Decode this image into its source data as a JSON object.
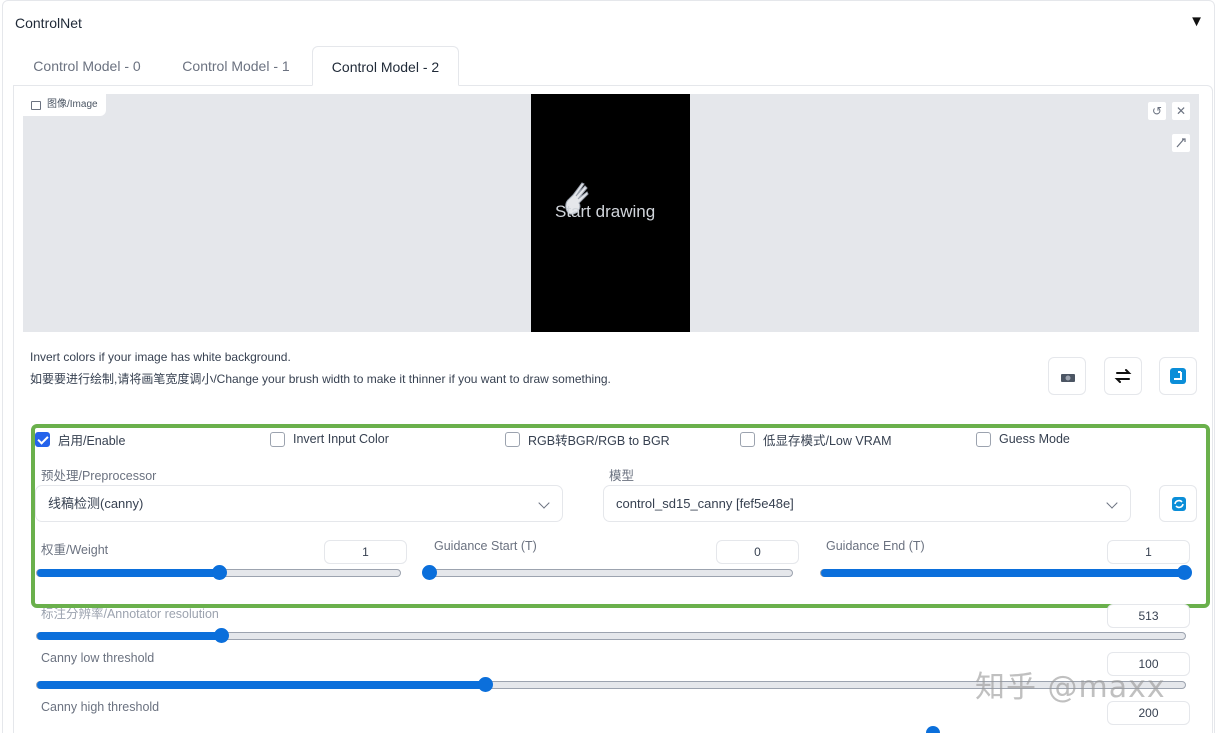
{
  "accordion": {
    "title": "ControlNet",
    "toggle_icon": "▼"
  },
  "tabs": [
    {
      "label": "Control Model - 0",
      "active": false
    },
    {
      "label": "Control Model - 1",
      "active": false
    },
    {
      "label": "Control Model - 2",
      "active": true
    }
  ],
  "image": {
    "label": "图像/Image",
    "placeholder": "Start drawing"
  },
  "hints": {
    "line1": "Invert colors if your image has white background.",
    "line2": "如要要进行绘制,请将画笔宽度调小/Change your brush width to make it thinner if you want to draw something."
  },
  "checkboxes": {
    "enable": {
      "label": "启用/Enable",
      "checked": true
    },
    "invert": {
      "label": "Invert Input Color",
      "checked": false
    },
    "rgb2bgr": {
      "label": "RGB转BGR/RGB to BGR",
      "checked": false
    },
    "lowvram": {
      "label": "低显存模式/Low VRAM",
      "checked": false
    },
    "guess": {
      "label": "Guess Mode",
      "checked": false
    }
  },
  "preprocessor": {
    "label": "预处理/Preprocessor",
    "value": "线稿检测(canny)"
  },
  "model": {
    "label": "模型",
    "value": "control_sd15_canny [fef5e48e]"
  },
  "weight": {
    "label": "权重/Weight",
    "value": "1",
    "fraction": 0.5
  },
  "guidance_start": {
    "label": "Guidance Start (T)",
    "value": "0",
    "fraction": 0
  },
  "guidance_end": {
    "label": "Guidance End (T)",
    "value": "1",
    "fraction": 1
  },
  "annotator_resolution": {
    "label": "标注分辨率/Annotator resolution",
    "value": "513",
    "fraction": 0.16
  },
  "canny_low": {
    "label": "Canny low threshold",
    "value": "100",
    "fraction": 0.39
  },
  "canny_high": {
    "label": "Canny high threshold",
    "value": "200"
  },
  "watermark": "知乎 @maxx",
  "colors": {
    "accent": "#0b6fdb",
    "highlight": "#6ab04c",
    "canvas": "#000000"
  }
}
